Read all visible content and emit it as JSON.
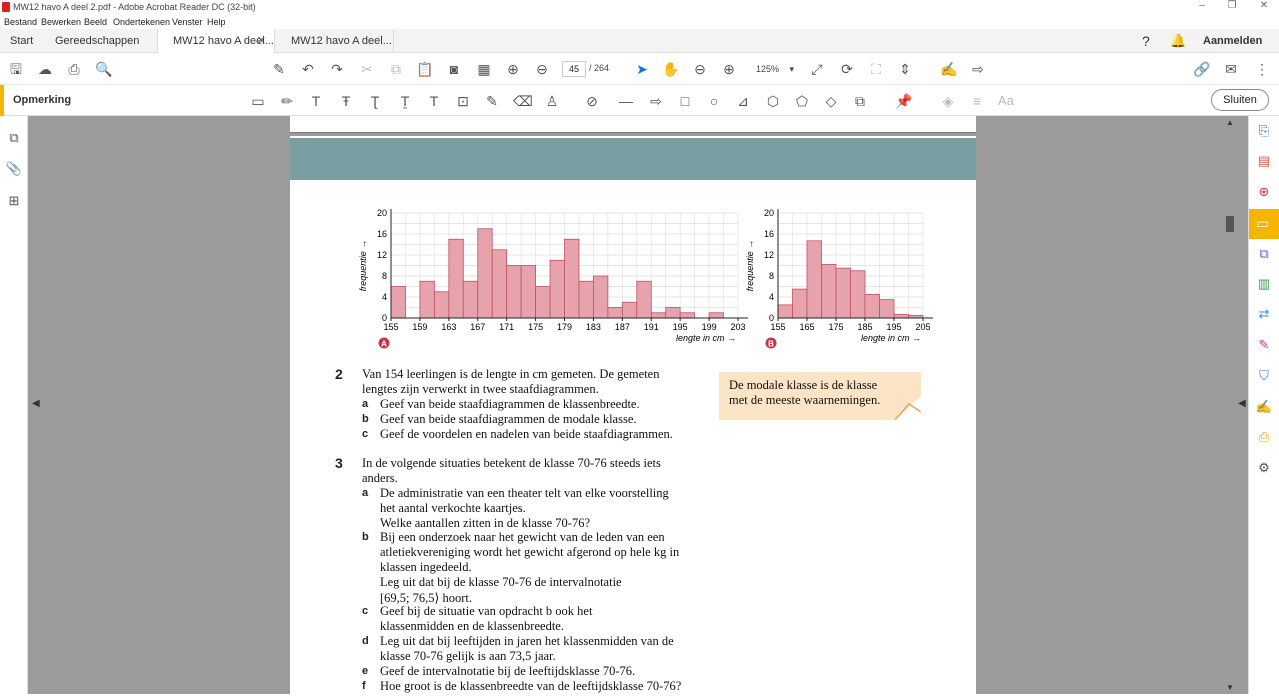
{
  "window": {
    "title": "MW12 havo A deel 2.pdf - Adobe Acrobat Reader DC (32-bit)"
  },
  "menu": [
    "Bestand",
    "Bewerken",
    "Beeld",
    "Ondertekenen",
    "Venster",
    "Help"
  ],
  "tabs": {
    "start": "Start",
    "tools": "Gereedschappen",
    "doc1": "MW12 havo A deel...",
    "doc2": "MW12 havo A deel..."
  },
  "account": {
    "signin": "Aanmelden"
  },
  "toolbar": {
    "page_current": "45",
    "page_total": "/ 264",
    "zoom": "125%"
  },
  "comment": {
    "label": "Opmerking",
    "close": "Sluiten"
  },
  "icons": {
    "save": "save-icon",
    "upload": "cloud-upload-icon",
    "print": "print-icon",
    "find": "zoom-search-icon"
  },
  "chart_data": [
    {
      "type": "bar",
      "label": "A",
      "xlabel": "lengte in cm",
      "ylabel": "frequentie",
      "ylim": [
        0,
        20
      ],
      "yticks": [
        "0",
        "4",
        "8",
        "12",
        "16",
        "20"
      ],
      "xticks": [
        "155",
        "159",
        "163",
        "167",
        "171",
        "175",
        "179",
        "183",
        "187",
        "191",
        "195",
        "199",
        "203"
      ],
      "bin_start": 155,
      "bin_width": 2,
      "values": [
        6,
        0,
        7,
        5,
        15,
        7,
        17,
        13,
        10,
        10,
        6,
        11,
        15,
        7,
        8,
        2,
        3,
        7,
        1,
        2,
        1,
        0,
        1,
        0
      ]
    },
    {
      "type": "bar",
      "label": "B",
      "xlabel": "lengte in cm",
      "ylabel": "frequentie",
      "ylim": [
        0,
        20
      ],
      "yticks": [
        "0",
        "4",
        "8",
        "12",
        "16",
        "20"
      ],
      "xticks": [
        "155",
        "165",
        "175",
        "185",
        "195",
        "205"
      ],
      "bin_start": 155,
      "bin_width": 5,
      "values": [
        2.5,
        5.5,
        14.7,
        10.2,
        9.5,
        9,
        4.5,
        3.5,
        0.7,
        0.5
      ]
    }
  ],
  "content": {
    "q2": {
      "num": "2",
      "lines": [
        "Van 154 leerlingen is de lengte in cm gemeten. De gemeten",
        "lengtes zijn verwerkt in twee staafdiagrammen."
      ],
      "a": "Geef van beide staafdiagrammen de klassenbreedte.",
      "b": "Geef van beide staafdiagrammen de modale klasse.",
      "c": "Geef de voordelen en nadelen van beide staafdiagrammen."
    },
    "note": [
      "De modale klasse is de klasse",
      "met de meeste waarnemingen."
    ],
    "q3": {
      "num": "3",
      "lines": [
        "In de volgende situaties betekent de klasse 70-76 steeds iets",
        "anders."
      ],
      "a": [
        "De administratie van een theater telt van elke voorstelling",
        "het aantal verkochte kaartjes.",
        "Welke aantallen zitten in de klasse 70-76?"
      ],
      "b": [
        "Bij een onderzoek naar het gewicht van de leden van een",
        "atletiekvereniging wordt het gewicht afgerond op hele kg in",
        "klassen ingedeeld.",
        "Leg uit dat bij de klasse 70-76 de intervalnotatie",
        "[69,5; 76,5⟩ hoort."
      ],
      "c": [
        "Geef bij de situatie van opdracht b ook het",
        "klassenmidden en de klassenbreedte."
      ],
      "d": [
        "Leg uit dat bij leeftijden in jaren het klassenmidden van de",
        "klasse 70-76 gelijk is aan 73,5 jaar."
      ],
      "e": [
        "Geef de intervalnotatie bij de leeftijdsklasse 70-76."
      ],
      "f": [
        "Hoe groot is de klassenbreedte van de leeftijdsklasse 70-76?"
      ]
    }
  }
}
